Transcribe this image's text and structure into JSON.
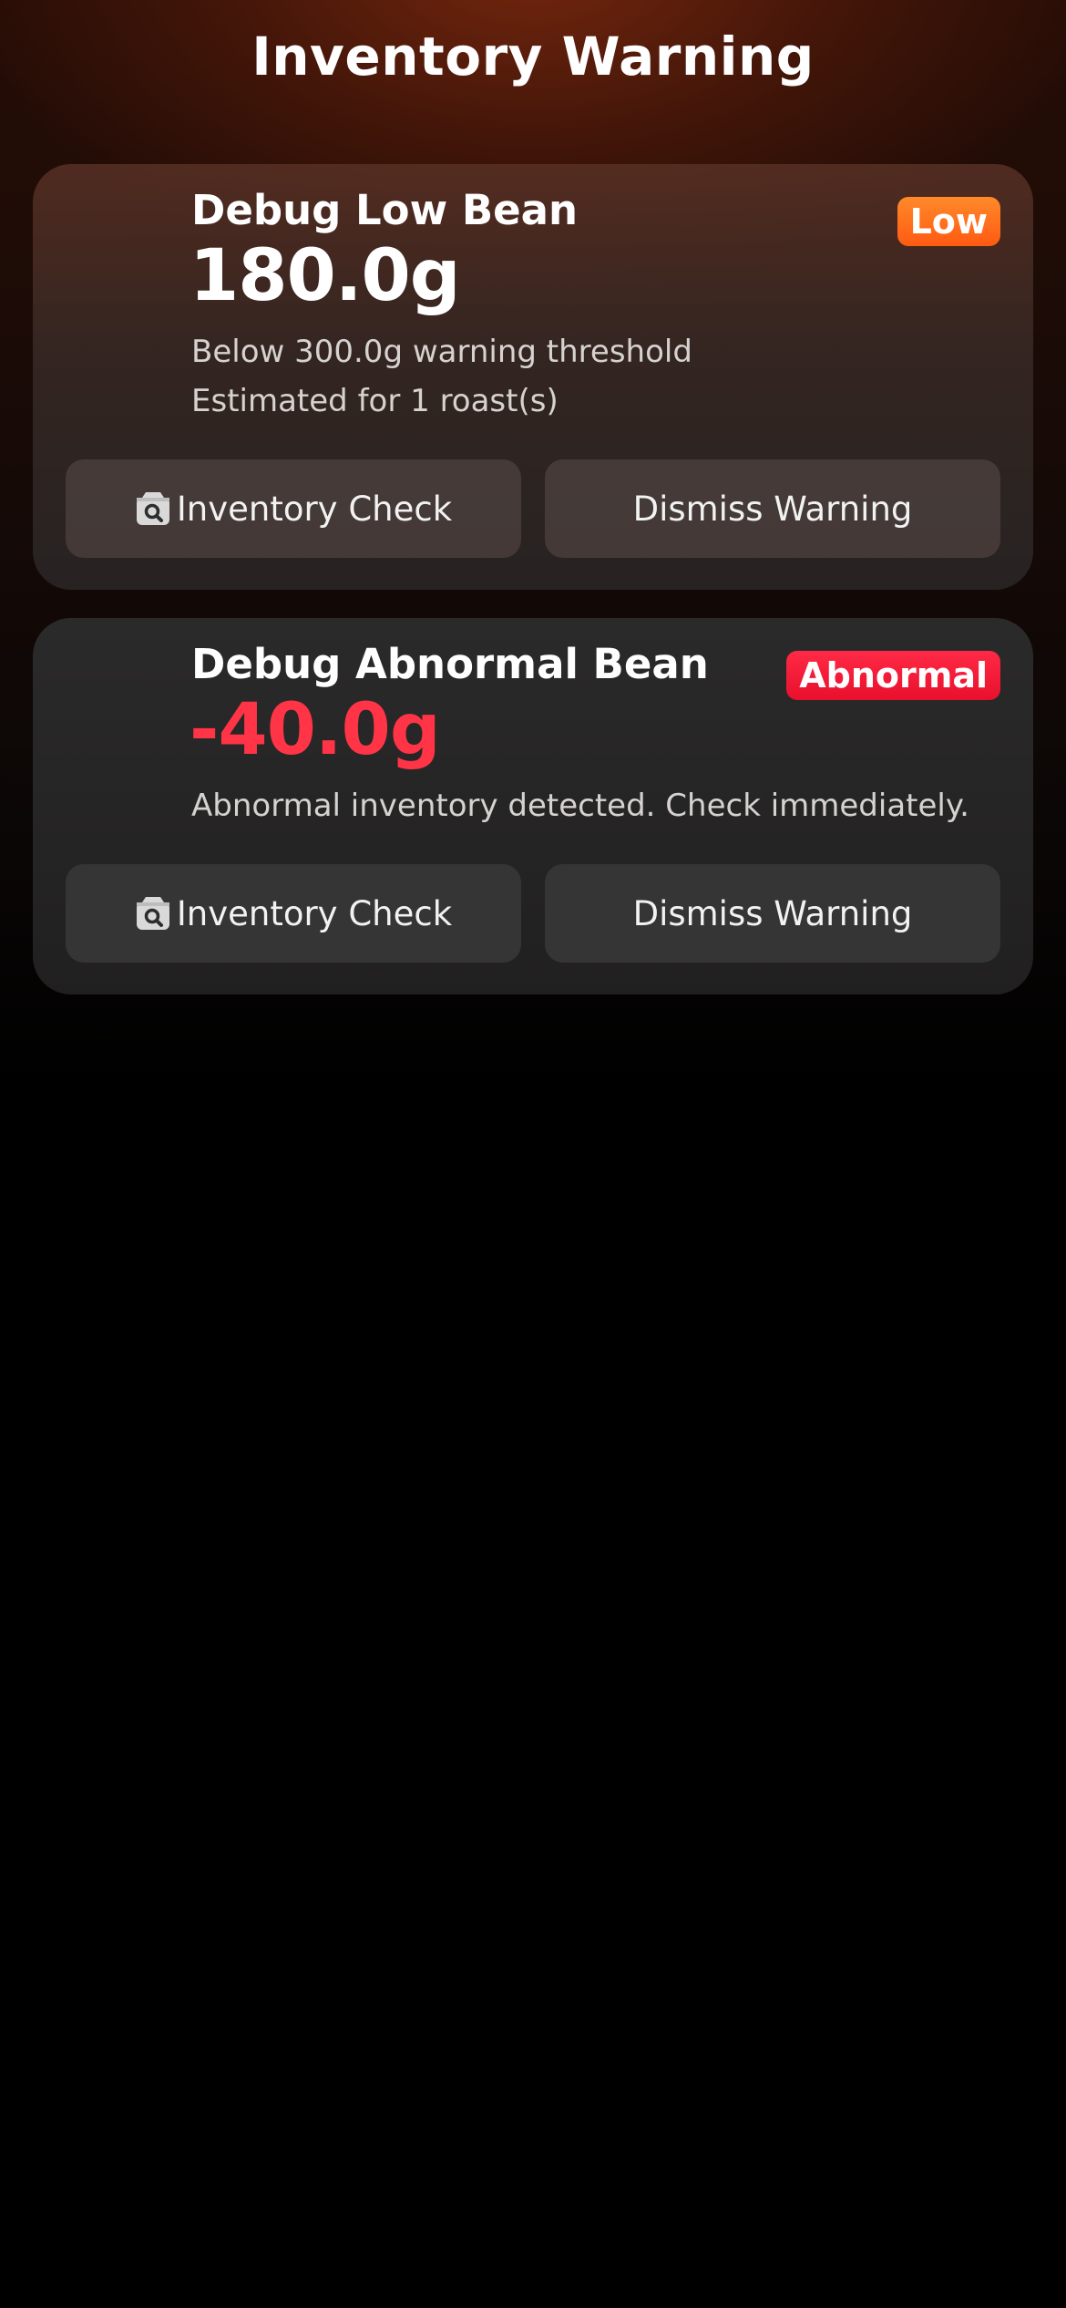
{
  "header": {
    "title": "Inventory Warning"
  },
  "cards": [
    {
      "bean_name": "Debug Low Bean",
      "amount": "180.0g",
      "badge": "Low",
      "lines": [
        "Below 300.0g warning threshold",
        "Estimated for 1 roast(s)"
      ],
      "check_label": "Inventory Check",
      "dismiss_label": "Dismiss Warning",
      "badge_color": "#ff6a1a",
      "amount_color": "#ffffff"
    },
    {
      "bean_name": "Debug Abnormal Bean",
      "amount": "-40.0g",
      "badge": "Abnormal",
      "lines": [
        "Abnormal inventory detected. Check immediately."
      ],
      "check_label": "Inventory Check",
      "dismiss_label": "Dismiss Warning",
      "badge_color": "#f0193a",
      "amount_color": "#ff3446"
    }
  ],
  "icons": {
    "check_button_icon": "inventory-search-icon"
  }
}
